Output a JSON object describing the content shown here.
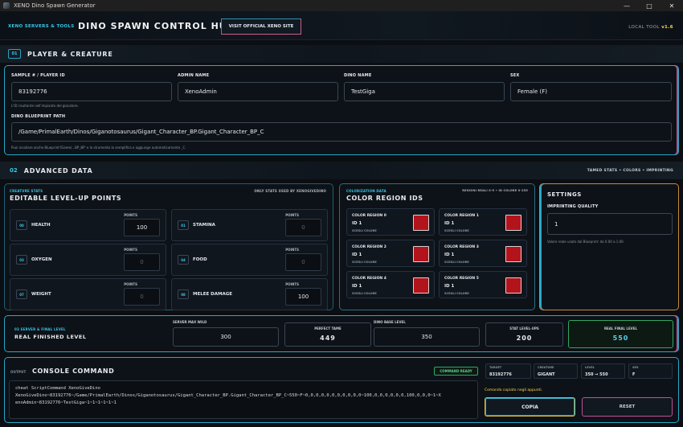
{
  "window": {
    "title": "XENO Dino Spawn Generator"
  },
  "header": {
    "brand": "XENO SERVERS & TOOLS",
    "title": "DINO SPAWN CONTROL HUB",
    "visit_label": "VISIT OFFICIAL XENO SITE",
    "local_tool": "LOCAL TOOL",
    "version": "v1.6"
  },
  "section1": {
    "num": "01",
    "title": "PLAYER & CREATURE",
    "player_id_label": "SAMPLE # / PLAYER ID",
    "player_id_value": "83192776",
    "player_id_hint": "L'ID risultante nell'impianto del giocatore.",
    "admin_label": "ADMIN NAME",
    "admin_value": "XenoAdmin",
    "dino_name_label": "DINO NAME",
    "dino_name_value": "TestGiga",
    "sex_label": "SEX",
    "sex_value": "Female (F)",
    "blueprint_label": "DINO BLUEPRINT PATH",
    "blueprint_value": "/Game/PrimalEarth/Dinos/Giganotosaurus/Gigant_Character_BP.Gigant_Character_BP_C",
    "blueprint_hint": "Puoi incollare anche Blueprint'/Game/...BP_BP' e lo strumento lo semplifica e aggiunge automaticamente _C."
  },
  "section2": {
    "num": "02",
    "title": "ADVANCED DATA",
    "right_label": "TAMED STATS • COLORS • IMPRINTING"
  },
  "stats": {
    "kicker": "CREATURE STATS",
    "title": "EDITABLE LEVEL-UP POINTS",
    "note": "ONLY STATS USED BY XENOGIVEDINO",
    "points_label": "POINTS",
    "items": [
      {
        "abbr": "00",
        "name": "HEALTH",
        "value": "100",
        "dim": false
      },
      {
        "abbr": "01",
        "name": "STAMINA",
        "value": "0",
        "dim": true
      },
      {
        "abbr": "03",
        "name": "OXYGEN",
        "value": "0",
        "dim": true
      },
      {
        "abbr": "04",
        "name": "FOOD",
        "value": "0",
        "dim": true
      },
      {
        "abbr": "07",
        "name": "WEIGHT",
        "value": "0",
        "dim": true
      },
      {
        "abbr": "08",
        "name": "MELEE DAMAGE",
        "value": "100",
        "dim": false
      }
    ]
  },
  "colors": {
    "kicker": "COLORIZATION DATA",
    "title": "COLOR REGION IDS",
    "note": "REGIONI REALI 0-5 • ID COLORE 0-255",
    "choose_label": "SCEGLI COLORE",
    "items": [
      {
        "name": "COLOR REGION 0",
        "id": "ID 1",
        "color": "#b3141c"
      },
      {
        "name": "COLOR REGION 1",
        "id": "ID 1",
        "color": "#b3141c"
      },
      {
        "name": "COLOR REGION 2",
        "id": "ID 1",
        "color": "#b3141c"
      },
      {
        "name": "COLOR REGION 3",
        "id": "ID 1",
        "color": "#b3141c"
      },
      {
        "name": "COLOR REGION 4",
        "id": "ID 1",
        "color": "#b3141c"
      },
      {
        "name": "COLOR REGION 5",
        "id": "ID 1",
        "color": "#b3141c"
      }
    ]
  },
  "settings": {
    "title": "SETTINGS",
    "imprint_label": "IMPRINTING QUALITY",
    "imprint_value": "1",
    "imprint_hint": "Valore reale usato dal Blueprint: da 0.00 a 1.00."
  },
  "final_level": {
    "kicker": "03 SERVER & FINAL LEVEL",
    "title": "REAL FINISHED LEVEL",
    "server_max_wild_label": "SERVER MAX WILD",
    "server_max_wild_value": "300",
    "perfect_tame_label": "PERFECT TAME",
    "perfect_tame_value": "449",
    "dino_base_level_label": "DINO BASE LEVEL",
    "dino_base_level_value": "350",
    "stat_levelups_label": "STAT LEVEL-UPS",
    "stat_levelups_value": "200",
    "real_final_level_label": "REAL FINAL LEVEL",
    "real_final_level_value": "550"
  },
  "console": {
    "kicker": "OUTPUT",
    "title": "CONSOLE COMMAND",
    "ready_badge": "COMMAND READY",
    "line1": "cheat ScriptCommand XenoGiveDino",
    "line2": "XenoGiveDino~83192776~/Game/PrimalEarth/Dinos/Giganotosaurus/Gigant_Character_BP.Gigant_Character_BP_C~550~F~0,0,0,0,0,0,0,0,0,0,0~100,0,0,0,0,0,0,100,0,0,0~1~X",
    "line3": "enoAdmin~83192776~TestGiga~1~1~1~1~1~1",
    "target_label": "TARGET",
    "target_value": "83192776",
    "creature_label": "CREATURE",
    "creature_value": "GIGANT",
    "level_label": "LEVEL",
    "level_value": "350 → 550",
    "sex_label": "SEX",
    "sex_value": "F",
    "copied_text": "Comando copiato negli appunti.",
    "copy_label": "COPIA",
    "reset_label": "RESET"
  },
  "theme": {
    "accent": "#36c6e6",
    "pink": "#c24f83",
    "gold": "#ffd64a",
    "green": "#5ad08a"
  }
}
